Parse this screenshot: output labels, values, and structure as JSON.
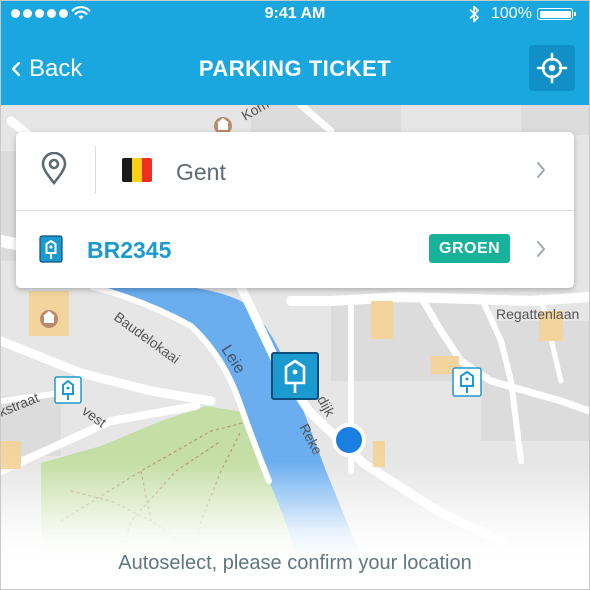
{
  "status_bar": {
    "signal_dots": 5,
    "time": "9:41 AM",
    "battery_text": "100%",
    "battery_level": 1.0
  },
  "navbar": {
    "back_label": "Back",
    "title": "PARKING TICKET",
    "locate_icon": "crosshair-icon"
  },
  "card": {
    "location_icon": "map-pin-icon",
    "city": "Gent",
    "flag_colors": [
      "#1a1a1a",
      "#fbd116",
      "#ee2e24"
    ],
    "plate": "BR2345",
    "plate_icon": "parking-tag-icon",
    "zone_badge": "GROEN",
    "zone_color": "#18b29a"
  },
  "map": {
    "streets": {
      "regattenlaan": "Regattenlaan",
      "baudelokaai": "Baudelokaai",
      "river": "Leie",
      "kstraat": "kstraat",
      "vest": "vest",
      "dijk": "dijk",
      "reke": "Reke",
      "kom": "Kom"
    }
  },
  "hint": "Autoselect, please confirm your location",
  "colors": {
    "accent": "#1aa7e0",
    "plate_text": "#1b9ad0",
    "water": "#6aaef0",
    "park": "#c4dea5",
    "location_dot": "#1a7fe0"
  }
}
